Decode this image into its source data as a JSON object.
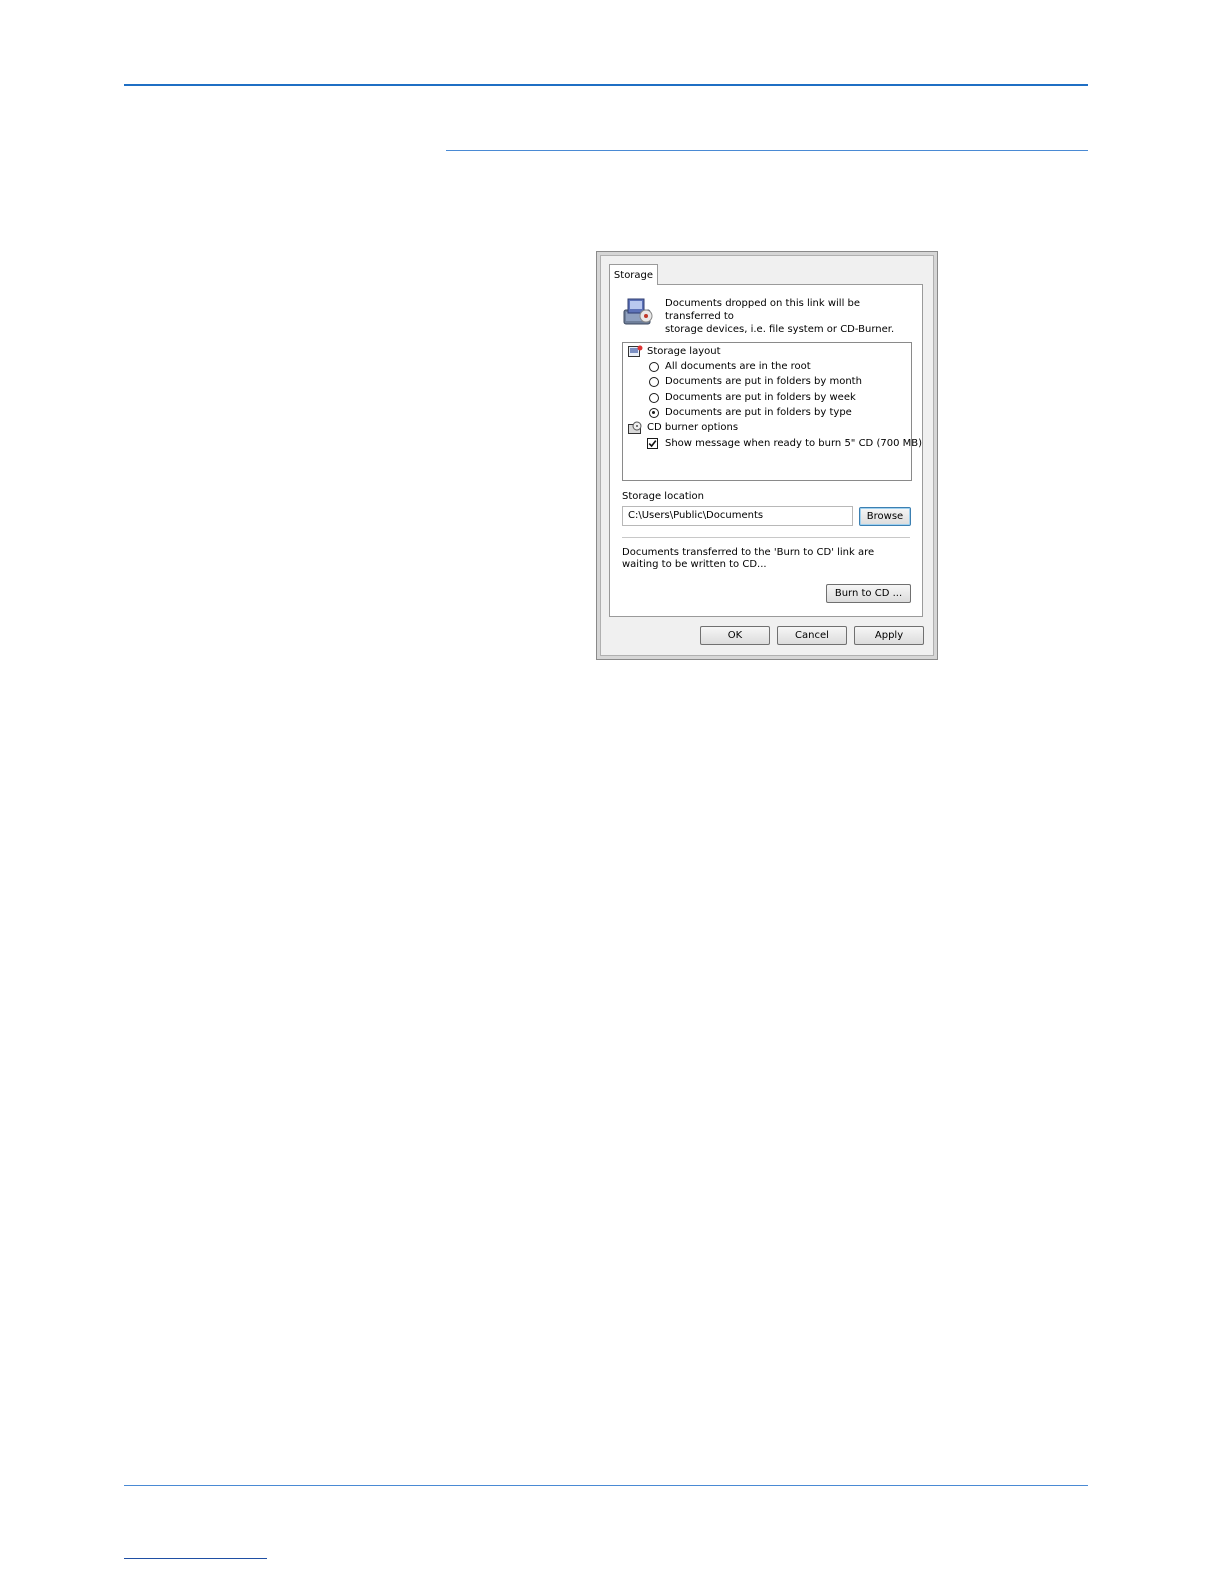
{
  "dialog": {
    "tab_label": "Storage",
    "description": "Documents dropped on this link will be transferred to\nstorage devices, i.e. file system or CD-Burner.",
    "layout_group": {
      "title": "Storage layout",
      "options": [
        {
          "label": "All documents are in the root",
          "selected": false
        },
        {
          "label": "Documents are put in folders by month",
          "selected": false
        },
        {
          "label": "Documents are put in folders by week",
          "selected": false
        },
        {
          "label": "Documents are put in folders by type",
          "selected": true
        }
      ]
    },
    "cd_group": {
      "title": "CD burner options",
      "checkbox_label": "Show message when ready to burn 5\" CD (700 MB)",
      "checked": true
    },
    "storage_location": {
      "label": "Storage location",
      "value": "C:\\Users\\Public\\Documents",
      "browse_label": "Browse"
    },
    "burn_note": "Documents transferred to the 'Burn to CD' link are waiting to be written to CD...",
    "burn_button": "Burn to CD ...",
    "ok_label": "OK",
    "cancel_label": "Cancel",
    "apply_label": "Apply"
  }
}
